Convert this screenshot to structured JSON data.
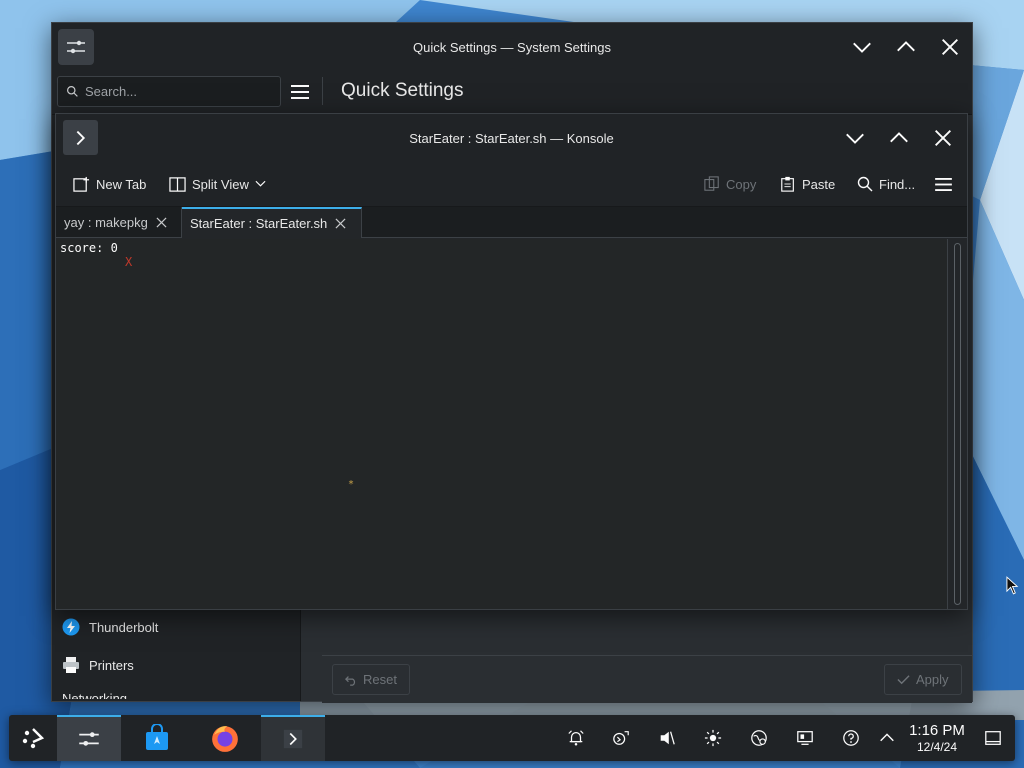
{
  "system_settings": {
    "title": "Quick Settings — System Settings",
    "search_placeholder": "Search...",
    "page_title": "Quick Settings",
    "sidebar": {
      "items": [
        {
          "label": "Thunderbolt",
          "icon": "thunderbolt-icon"
        },
        {
          "label": "Printers",
          "icon": "printer-icon"
        }
      ],
      "cut_label": "Networking"
    },
    "footer": {
      "reset_label": "Reset",
      "apply_label": "Apply"
    }
  },
  "konsole": {
    "title": "StarEater : StarEater.sh — Konsole",
    "toolbar": {
      "new_tab": "New Tab",
      "split_view": "Split View",
      "copy": "Copy",
      "paste": "Paste",
      "find": "Find..."
    },
    "tabs": [
      {
        "label": "yay : makepkg",
        "active": false
      },
      {
        "label": "StarEater : StarEater.sh",
        "active": true
      }
    ],
    "terminal": {
      "score_line": "score: 0",
      "player_char": "X",
      "star_char": "*"
    }
  },
  "taskbar": {
    "apps": [
      "app-launcher-icon",
      "system-settings-icon",
      "discover-store-icon",
      "firefox-icon",
      "konsole-icon"
    ],
    "tray": [
      "notifications-icon",
      "kde-connect-icon",
      "volume-muted-icon",
      "brightness-icon",
      "network-icon",
      "display-config-icon",
      "help-icon",
      "tray-expand-icon"
    ],
    "clock_time": "1:16 PM",
    "clock_date": "12/4/24"
  },
  "colors": {
    "accent": "#3daee9",
    "window_bg": "#202326",
    "terminal_bg": "#232627",
    "player_red": "#c0392b",
    "star_gold": "#c8a24a"
  }
}
